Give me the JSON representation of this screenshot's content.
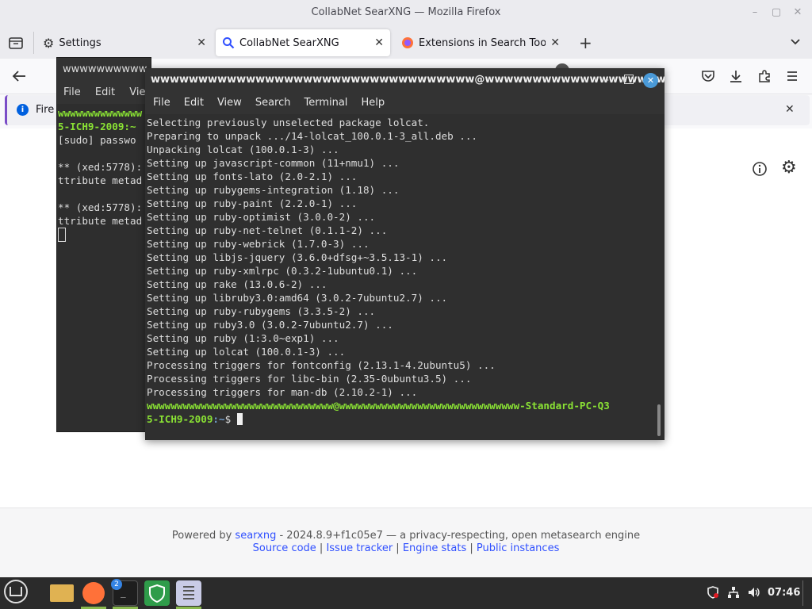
{
  "firefox": {
    "window_title": "CollabNet SearXNG — Mozilla Firefox",
    "tabs": [
      {
        "label": "Settings",
        "icon": "gear-icon",
        "active": false
      },
      {
        "label": "CollabNet SearXNG",
        "icon": "search-icon",
        "active": true
      },
      {
        "label": "Extensions in Search Tools",
        "icon": "firefox-icon",
        "active": false
      }
    ],
    "infobar_text": "Fire",
    "footer": {
      "powered_by": "Powered by",
      "searxng_link": "searxng",
      "version_text": " - 2024.8.9+f1c05e7 — a privacy-respecting, open metasearch engine",
      "links": [
        "Source code",
        "Issue tracker",
        "Engine stats",
        "Public instances"
      ],
      "separator": " | "
    }
  },
  "terminal_back": {
    "title": "wwwwwwwwww",
    "menu": [
      "File",
      "Edit",
      "View"
    ],
    "lines": [
      {
        "text": "wwwwwwwwwwwwww",
        "cls": "green"
      },
      {
        "text": "5-ICH9-2009:~",
        "cls": "green"
      },
      {
        "text": "[sudo] passwo",
        "cls": ""
      },
      {
        "text": "",
        "cls": ""
      },
      {
        "text": "** (xed:5778):",
        "cls": ""
      },
      {
        "text": "ttribute metad",
        "cls": ""
      },
      {
        "text": "",
        "cls": ""
      },
      {
        "text": "** (xed:5778):",
        "cls": ""
      },
      {
        "text": "ttribute metad",
        "cls": ""
      }
    ]
  },
  "terminal_front": {
    "title": "wwwwwwwwwwwwwwwwwwwwwwwwwwwwwwwwww@wwwwwwwwwwwwwwwwwwwww...",
    "menu": [
      "File",
      "Edit",
      "View",
      "Search",
      "Terminal",
      "Help"
    ],
    "lines": [
      "Selecting previously unselected package lolcat.",
      "Preparing to unpack .../14-lolcat_100.0.1-3_all.deb ...",
      "Unpacking lolcat (100.0.1-3) ...",
      "Setting up javascript-common (11+nmu1) ...",
      "Setting up fonts-lato (2.0-2.1) ...",
      "Setting up rubygems-integration (1.18) ...",
      "Setting up ruby-paint (2.2.0-1) ...",
      "Setting up ruby-optimist (3.0.0-2) ...",
      "Setting up ruby-net-telnet (0.1.1-2) ...",
      "Setting up ruby-webrick (1.7.0-3) ...",
      "Setting up libjs-jquery (3.6.0+dfsg+~3.5.13-1) ...",
      "Setting up ruby-xmlrpc (0.3.2-1ubuntu0.1) ...",
      "Setting up rake (13.0.6-2) ...",
      "Setting up libruby3.0:amd64 (3.0.2-7ubuntu2.7) ...",
      "Setting up ruby-rubygems (3.3.5-2) ...",
      "Setting up ruby3.0 (3.0.2-7ubuntu2.7) ...",
      "Setting up ruby (1:3.0~exp1) ...",
      "Setting up lolcat (100.0.1-3) ...",
      "Processing triggers for fontconfig (2.13.1-4.2ubuntu5) ...",
      "Processing triggers for libc-bin (2.35-0ubuntu3.5) ...",
      "Processing triggers for man-db (2.10.2-1) ..."
    ],
    "prompt_user_host": "wwwwwwwwwwwwwwwwwwwwwwwwwwwwwww@wwwwwwwwwwwwwwwwwwwwwwwwwwwwww-Standard-PC-Q3",
    "prompt_host2": "5-ICH9-2009",
    "prompt_path": ":~",
    "prompt_symbol": "$ "
  },
  "taskbar": {
    "terminal_badge": "2",
    "clock": "07:46"
  }
}
